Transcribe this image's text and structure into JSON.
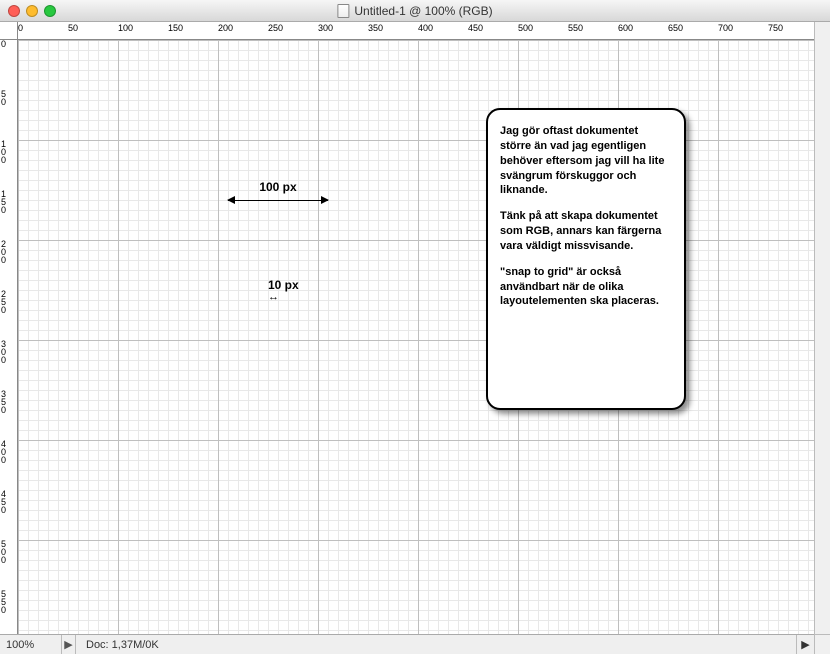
{
  "title": "Untitled-1 @ 100% (RGB)",
  "ruler_h": [
    0,
    50,
    100,
    150,
    200,
    250,
    300,
    350,
    400,
    450,
    500,
    550,
    600,
    650,
    700,
    750
  ],
  "ruler_v": [
    "0",
    "5",
    "0",
    "1",
    "0",
    "1",
    "5",
    "0",
    "2",
    "0",
    "2",
    "5",
    "0",
    "3",
    "0",
    "3",
    "5",
    "0",
    "4",
    "0",
    "4",
    "5",
    "0",
    "5",
    "0",
    "5",
    "5",
    "0"
  ],
  "dim100_label": "100 px",
  "dim10_label": "10 px",
  "note": {
    "p1": "Jag gör oftast dokumentet större än vad jag egentligen behöver eftersom jag vill ha lite svängrum förskuggor och liknande.",
    "p2": "Tänk på att skapa dokumentet som RGB, annars kan färgerna vara väldigt missvisande.",
    "p3": "\"snap to grid\" är också användbart när de olika layoutelementen ska placeras."
  },
  "status": {
    "zoom": "100%",
    "arrow": "▶",
    "doc": "Doc: 1,37M/0K",
    "harrow": "▶"
  }
}
